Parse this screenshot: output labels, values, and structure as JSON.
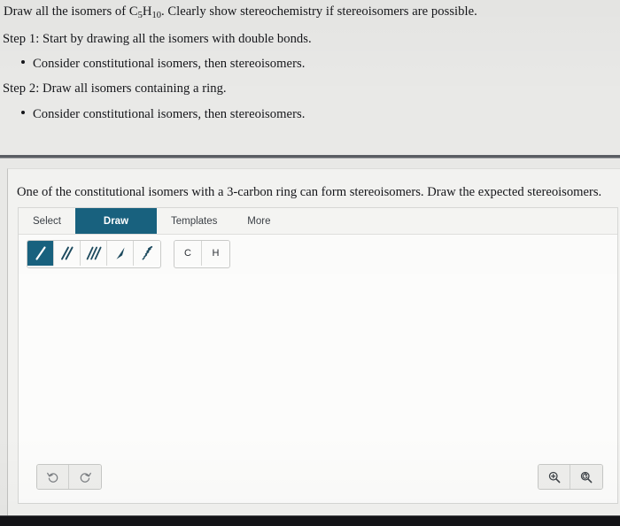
{
  "prompt": {
    "main_before": "Draw all the isomers of C",
    "main_sub1": "5",
    "main_mid": "H",
    "main_sub2": "10",
    "main_after": ". Clearly show stereochemistry if stereoisomers are possible.",
    "step1": "Step 1: Start by drawing all the isomers with double bonds.",
    "step1_bullet": "Consider constitutional isomers, then stereoisomers.",
    "step2": "Step 2: Draw all isomers containing a ring.",
    "step2_bullet": "Consider constitutional isomers, then stereoisomers."
  },
  "exercise": {
    "instruction": "One of the constitutional isomers with a 3-carbon ring can form stereoisomers. Draw the expected stereoisomers."
  },
  "editor": {
    "tabs": [
      {
        "label": "Select",
        "active": false
      },
      {
        "label": "Draw",
        "active": true
      },
      {
        "label": "Templates",
        "active": false
      },
      {
        "label": "More",
        "active": false
      }
    ],
    "bond_tools": [
      {
        "name": "single-bond-tool",
        "icon": "single-bond-icon",
        "active": true
      },
      {
        "name": "double-bond-tool",
        "icon": "double-bond-icon",
        "active": false
      },
      {
        "name": "triple-bond-tool",
        "icon": "triple-bond-icon",
        "active": false
      },
      {
        "name": "solid-wedge-bond-tool",
        "icon": "solid-wedge-icon",
        "active": false
      },
      {
        "name": "hashed-wedge-bond-tool",
        "icon": "hashed-wedge-icon",
        "active": false
      }
    ],
    "atom_tools": [
      {
        "label": "C",
        "name": "carbon-atom-tool"
      },
      {
        "label": "H",
        "name": "hydrogen-atom-tool"
      }
    ],
    "history_tools": [
      {
        "name": "undo-button",
        "icon": "undo-icon"
      },
      {
        "name": "redo-button",
        "icon": "redo-icon"
      }
    ],
    "view_tools": [
      {
        "name": "zoom-in-button",
        "icon": "zoom-in-icon"
      },
      {
        "name": "zoom-reset-button",
        "icon": "zoom-reset-icon"
      }
    ],
    "canvas_content": ""
  },
  "colors": {
    "accent_teal": "#18617e",
    "bond_ink": "#1d4a5e",
    "page_bg": "#e9e9e7",
    "panel_bg": "#f2f2f0",
    "canvas_bg": "#fcfcfb",
    "divider": "#5a5d63",
    "bottom_band": "#131316"
  }
}
